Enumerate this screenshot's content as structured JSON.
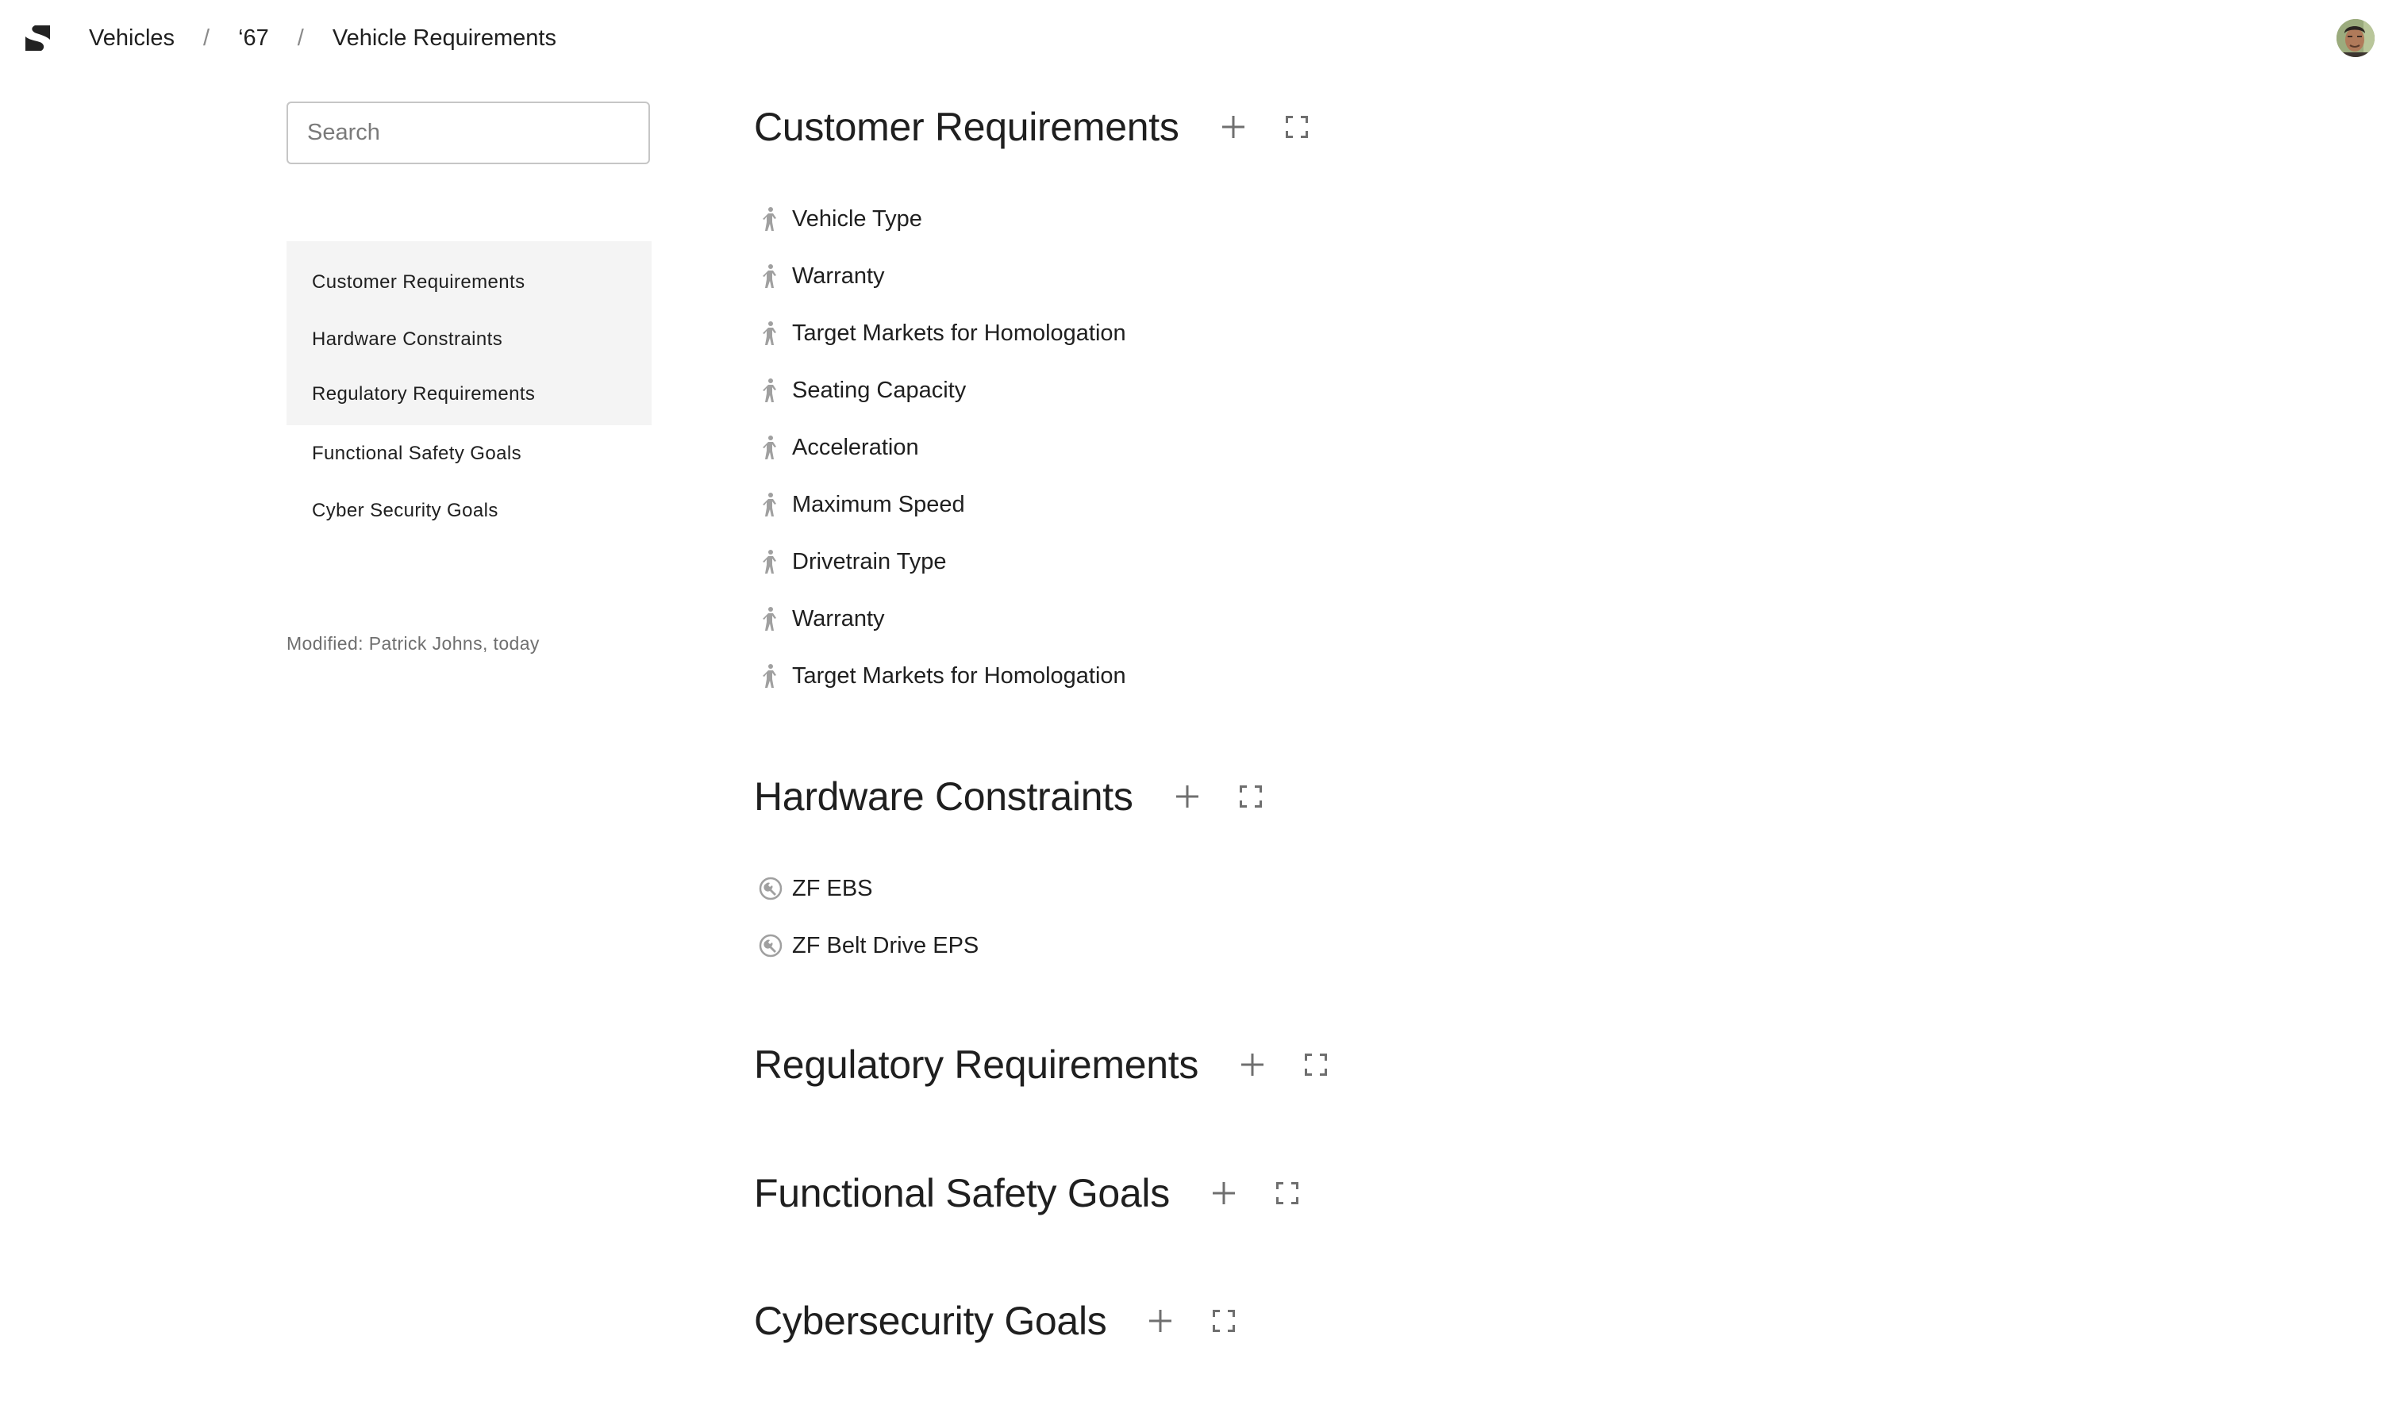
{
  "breadcrumb": {
    "items": [
      "Vehicles",
      "‘67",
      "Vehicle Requirements"
    ],
    "separator": "/"
  },
  "user": {
    "avatar_icon": "user-avatar"
  },
  "sidebar": {
    "search_placeholder": "Search",
    "search_value": "",
    "toc": [
      {
        "label": "Customer Requirements",
        "highlighted": true
      },
      {
        "label": "Hardware Constraints",
        "highlighted": true
      },
      {
        "label": "Regulatory Requirements",
        "highlighted": true
      },
      {
        "label": "Functional Safety Goals",
        "highlighted": false
      },
      {
        "label": "Cyber Security Goals",
        "highlighted": false
      }
    ],
    "modified": "Modified: Patrick Johns, today"
  },
  "sections": [
    {
      "title": "Customer Requirements",
      "item_icon": "walking-person-icon",
      "items": [
        "Vehicle Type",
        "Warranty",
        "Target Markets for Homologation",
        "Seating Capacity",
        "Acceleration",
        "Maximum Speed",
        "Drivetrain Type",
        "Warranty",
        "Target Markets for Homologation"
      ]
    },
    {
      "title": "Hardware Constraints",
      "item_icon": "wrench-circle-icon",
      "items": [
        "ZF EBS",
        "ZF Belt Drive EPS"
      ]
    },
    {
      "title": "Regulatory Requirements",
      "items": []
    },
    {
      "title": "Functional Safety Goals",
      "items": []
    },
    {
      "title": "Cybersecurity Goals",
      "items": []
    }
  ],
  "colors": {
    "text": "#1f1f1f",
    "icon": "#6f6f6f",
    "item_icon": "#a0a0a0",
    "toc_highlight": "#f4f4f4",
    "border": "#c6c6c6"
  }
}
